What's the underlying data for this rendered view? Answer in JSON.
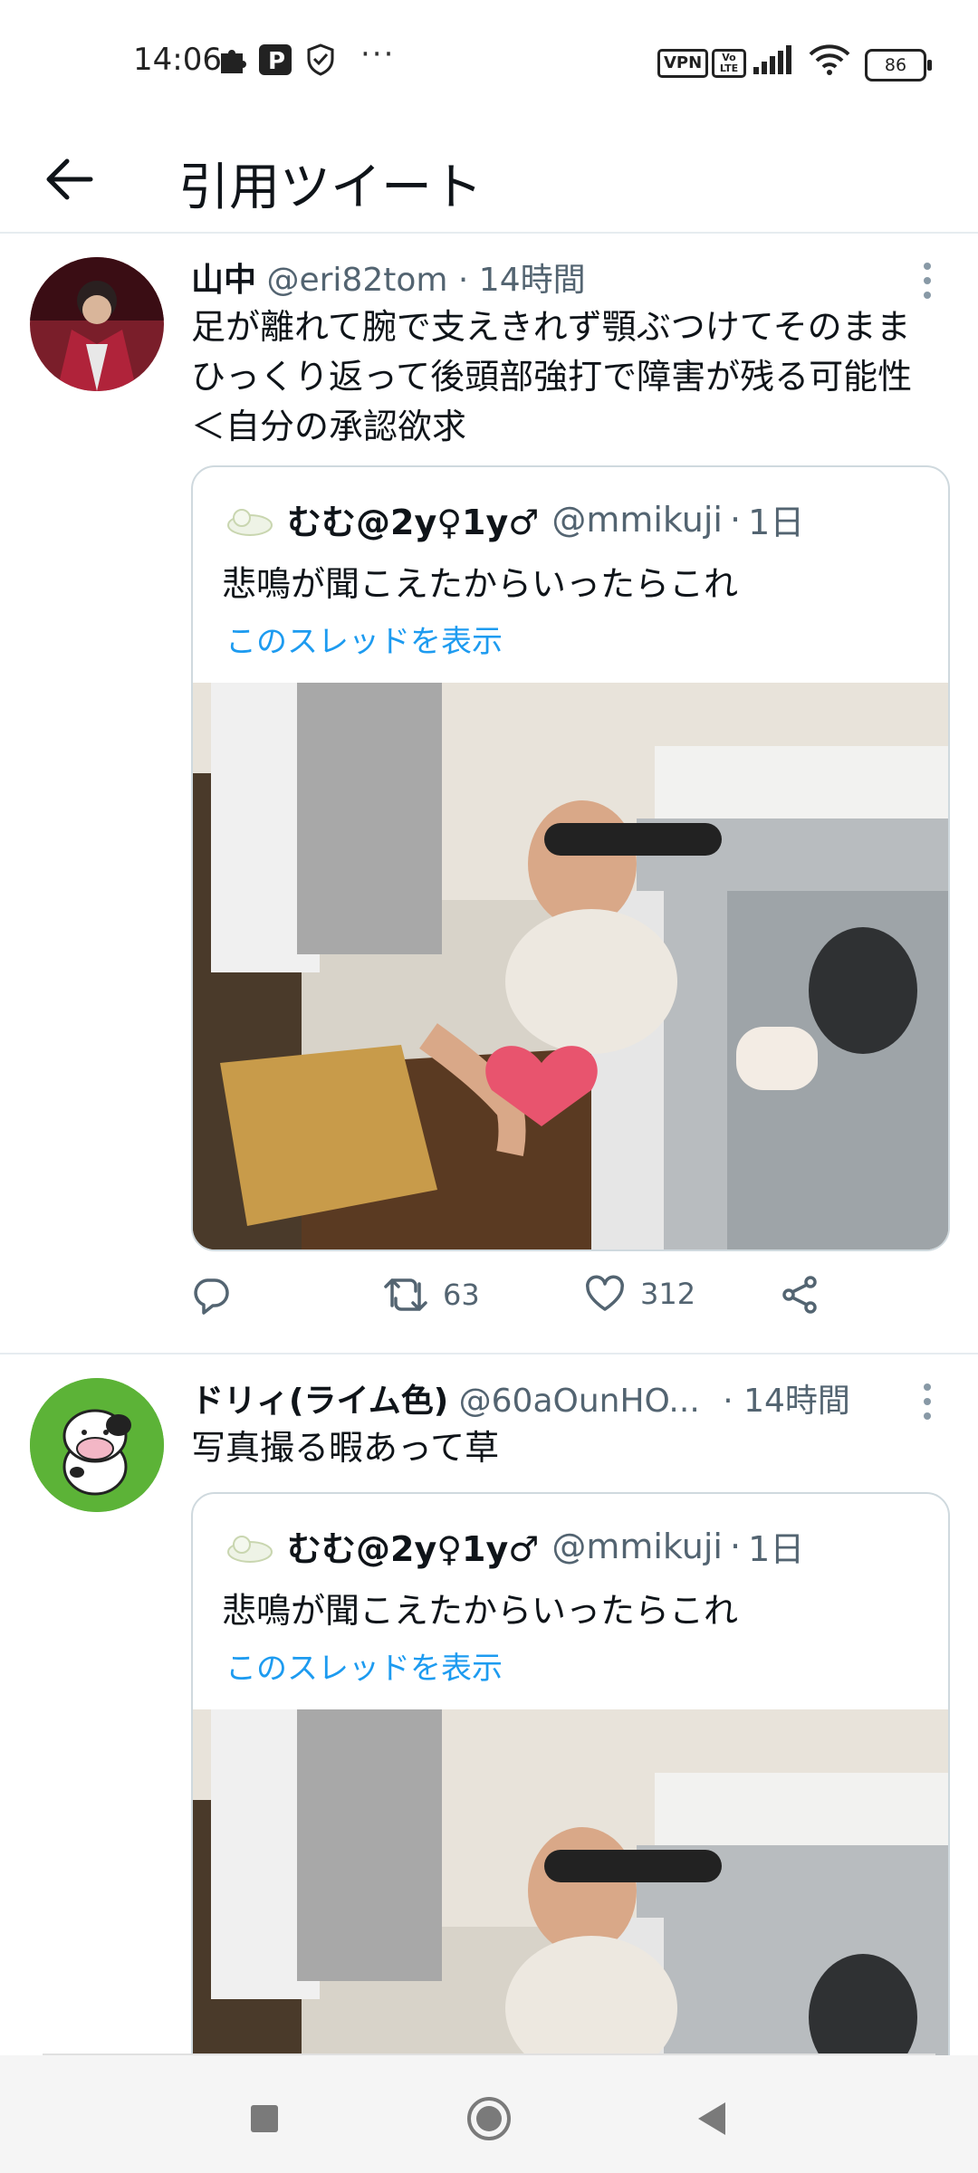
{
  "status_bar": {
    "time": "14:06",
    "more": "···",
    "vpn": "VPN",
    "volte": "Vo LTE",
    "battery": "86",
    "icons": [
      "puzzle-icon",
      "pay-icon",
      "shield-check-icon",
      "signal-icon",
      "wifi-icon"
    ]
  },
  "header": {
    "title": "引用ツイート",
    "back_icon": "arrow-left-icon"
  },
  "tweets": [
    {
      "name": "山中",
      "handle": "@eri82tom",
      "sep": "·",
      "time": "14時間",
      "text": "足が離れて腕で支えきれず顎ぶつけてそのままひっくり返って後頭部強打で障害が残る可能性＜自分の承認欲求",
      "quote": {
        "name": "むむ@2y♀1y♂",
        "handle": "@mmikuji",
        "sep": "·",
        "time": "1日",
        "text": "悲鳴が聞こえたからいったらこれ",
        "thread_link": "このスレッドを表示"
      },
      "actions": {
        "retweets": "63",
        "likes": "312"
      }
    },
    {
      "name": "ドリィ(ライム色)",
      "handle": "@60aOunHO...",
      "sep": "·",
      "time": "14時間",
      "text": "写真撮る暇あって草",
      "quote": {
        "name": "むむ@2y♀1y♂",
        "handle": "@mmikuji",
        "sep": "·",
        "time": "1日",
        "text": "悲鳴が聞こえたからいったらこれ",
        "thread_link": "このスレッドを表示"
      }
    }
  ],
  "colors": {
    "link": "#1d9bf0",
    "secondary": "#536471",
    "primary": "#0f1419",
    "border": "#cfd9de"
  },
  "nav_bar": {
    "buttons": [
      "recents-square-icon",
      "home-circle-icon",
      "back-triangle-icon"
    ]
  }
}
